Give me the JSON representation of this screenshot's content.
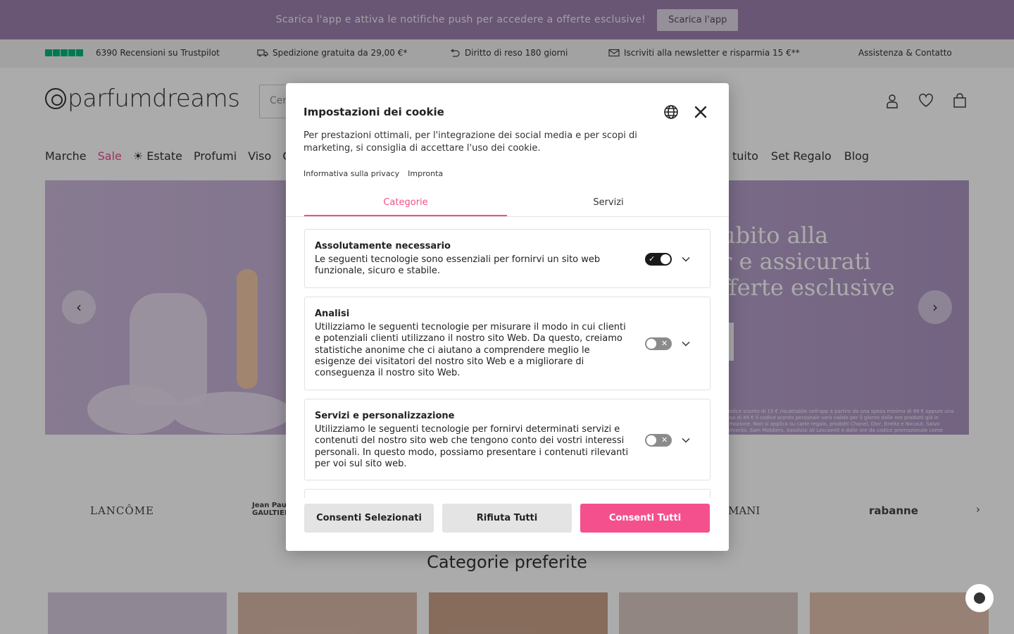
{
  "promo": {
    "text": "Scarica l'app e attiva le notifiche push per accedere a offerte esclusive!",
    "button": "Scarica l'app"
  },
  "usp": {
    "trustpilot": "6390 Recensioni su Trustpilot",
    "shipping": "Spedizione gratuita da 29,00 €*",
    "returns": "Diritto di reso 180 giorni",
    "newsletter": "Iscriviti alla newsletter e risparmia 15 €**",
    "support": "Assistenza & Contatto"
  },
  "header": {
    "logo": "parfumdreams",
    "search_placeholder": "Cer"
  },
  "nav": {
    "items": [
      "Marche",
      "Sale",
      "☀ Estate",
      "Profumi",
      "Viso",
      "C"
    ],
    "right": [
      "tuito",
      "Set Regalo",
      "Blog"
    ]
  },
  "hero": {
    "headline": [
      "ubito alla",
      "r e assicurati",
      "fferte esclusive"
    ],
    "fineprint": "e codice sconto di 15 € riscattabile nell'app a partire da una spesa minima di 99 € oppure una spesa di 49 € Il codice sconto personale sarà valido per il giorno dalle ore prodotti già in promozione. Non si applica su carte regalo, prodotti Chanel, Dior, Eneltz e Nocaut. Salvo intervento. Sam Mobbers, Assoluto all Lescaenit e dalle ore da codice promozionale come Extrait di Profumeria."
  },
  "brands": [
    "LANCÔME",
    "Jean Paul GAULTIER",
    "MANI",
    "rabanne"
  ],
  "categories_title": "Categorie preferite",
  "modal": {
    "title": "Impostazioni dei cookie",
    "description": "Per prestazioni ottimali, per l'integrazione dei social media e per scopi di marketing, si consiglia di accettare l'uso dei cookie.",
    "links": {
      "privacy": "Informativa sulla privacy",
      "imprint": "Impronta"
    },
    "tabs": {
      "categories": "Categorie",
      "services": "Servizi"
    },
    "cards": [
      {
        "title": "Assolutamente necessario",
        "desc": "Le seguenti tecnologie sono essenziali per fornirvi un sito web funzionale, sicuro e stabile.",
        "enabled": true
      },
      {
        "title": "Analisi",
        "desc": "Utilizziamo le seguenti tecnologie per misurare il modo in cui clienti e potenziali clienti utilizzano il nostro sito Web. Da questo, creiamo statistiche anonime che ci aiutano a comprendere meglio le esigenze dei visitatori del nostro sito Web e a migliorare di conseguenza il nostro sito Web.",
        "enabled": false
      },
      {
        "title": "Servizi e personalizzazione",
        "desc": "Utilizziamo le seguenti tecnologie per fornirvi determinati servizi e contenuti del nostro sito web che tengono conto dei vostri interessi personali. In questo modo, possiamo presentare i contenuti rilevanti per voi sul sito web.",
        "enabled": false
      }
    ],
    "buttons": {
      "allow_selected": "Consenti Selezionati",
      "reject_all": "Rifiuta Tutti",
      "allow_all": "Consenti Tutti"
    }
  },
  "colors": {
    "accent": "#f4508d",
    "promo_bar": "#9c80ad",
    "trustpilot": "#00b67a"
  }
}
